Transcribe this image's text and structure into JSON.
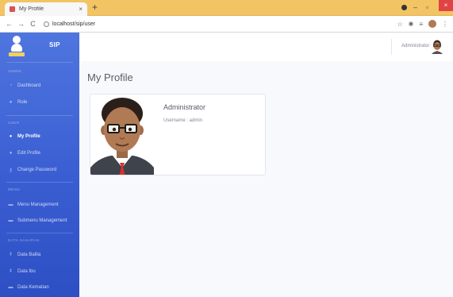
{
  "browser": {
    "tab_title": "My Profile",
    "tab_close": "×",
    "new_tab": "+",
    "minimize": "–",
    "maximize": "▫",
    "close": "×",
    "url": "localhost/sip/user",
    "icons": [
      "back-icon",
      "forward-icon",
      "reload-icon",
      "info-icon",
      "star-icon",
      "extensions-icon",
      "playlist-icon",
      "profile-icon",
      "menu-icon"
    ]
  },
  "sidebar": {
    "brand": "SIP",
    "logo_plate": "POSYANDU",
    "sections": [
      {
        "heading": "Admin",
        "items": [
          {
            "label": "Dashboard",
            "icon": "dashboard-icon",
            "active": false
          },
          {
            "label": "Role",
            "icon": "user-icon",
            "active": false
          }
        ]
      },
      {
        "heading": "User",
        "items": [
          {
            "label": "My Profile",
            "icon": "user-icon",
            "active": true
          },
          {
            "label": "Edit Profile",
            "icon": "user-edit-icon",
            "active": false
          },
          {
            "label": "Change Password",
            "icon": "key-icon",
            "active": false
          }
        ]
      },
      {
        "heading": "Menu",
        "items": [
          {
            "label": "Menu Management",
            "icon": "folder-icon",
            "active": false
          },
          {
            "label": "Submenu Management",
            "icon": "folder-open-icon",
            "active": false
          }
        ]
      },
      {
        "heading": "Data Sasaran",
        "items": [
          {
            "label": "Data Balita",
            "icon": "child-icon",
            "active": false
          },
          {
            "label": "Data Ibu",
            "icon": "female-icon",
            "active": false
          },
          {
            "label": "Data Kematian",
            "icon": "folder-icon",
            "active": false
          }
        ]
      }
    ]
  },
  "topbar": {
    "user_name": "Administrator"
  },
  "main": {
    "page_title": "My Profile",
    "profile": {
      "name": "Administrator",
      "username_line": "Username : admin"
    }
  },
  "colors": {
    "sidebar_top": "#4f75df",
    "sidebar_bottom": "#2d4fc4",
    "tabstrip": "#f2c464",
    "content_bg": "#f8f9fc"
  }
}
